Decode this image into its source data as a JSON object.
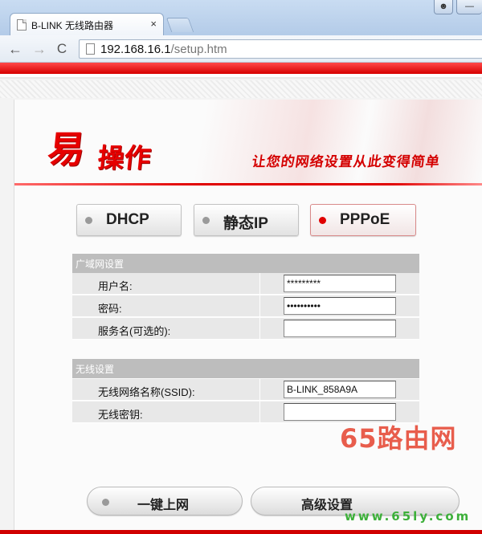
{
  "browser": {
    "tab_title": "B-LINK 无线路由器",
    "tab_close": "×",
    "url_host": "192.168.16.1",
    "url_path": "/setup.htm",
    "back_icon": "←",
    "forward_icon": "→",
    "reload_icon": "C"
  },
  "banner": {
    "logo_char_big": "易",
    "logo_chars_small": "操作",
    "slogan": "让您的网络设置从此变得简单"
  },
  "modes": [
    {
      "label": "DHCP",
      "active": false
    },
    {
      "label": "静态IP",
      "active": false
    },
    {
      "label": "PPPoE",
      "active": true
    }
  ],
  "wan": {
    "header": "广域网设置",
    "username_label": "用户名:",
    "username_value": "*********",
    "password_label": "密码:",
    "password_value": "••••••••••",
    "service_label": "服务名(可选的):",
    "service_value": ""
  },
  "wireless": {
    "header": "无线设置",
    "ssid_label": "无线网络名称(SSID):",
    "ssid_value": "B-LINK_858A9A",
    "key_label": "无线密钥:",
    "key_value": ""
  },
  "actions": {
    "oneclick_label": "一键上网",
    "advanced_label": "高级设置"
  },
  "watermark": {
    "brand": "65路由网",
    "url": "www.65ly.com"
  },
  "colors": {
    "accent_red": "#e00000",
    "section_gray": "#bdbdbd",
    "row_gray": "#e8e8e8"
  }
}
